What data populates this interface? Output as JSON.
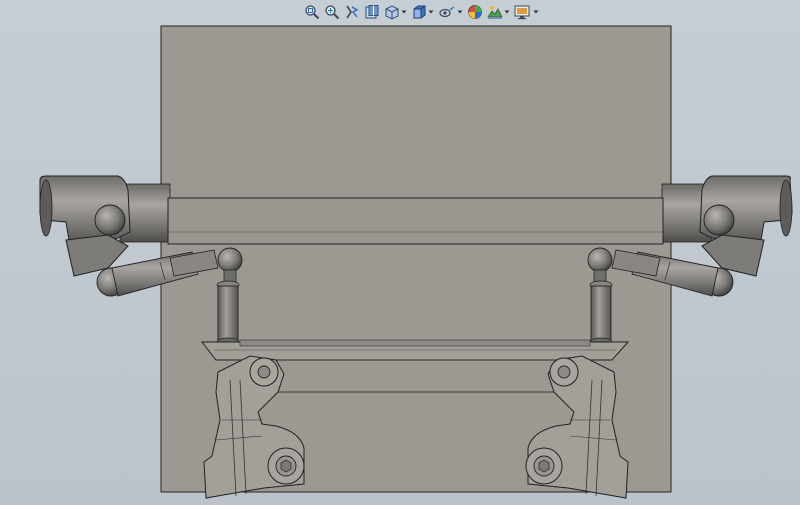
{
  "app": {
    "view": "cad-graphics-area"
  },
  "colors": {
    "background": "#c4ccd3",
    "plate": "#9c9892",
    "part": "#7d7b78",
    "part_light": "#a6a39f",
    "part_dark": "#4a4947",
    "edge": "#1e1e1e"
  },
  "toolbar": {
    "tools": [
      {
        "name": "zoom-to-fit-icon",
        "has_menu": false
      },
      {
        "name": "zoom-to-area-icon",
        "has_menu": false
      },
      {
        "name": "previous-view-icon",
        "has_menu": false
      },
      {
        "name": "section-view-icon",
        "has_menu": false
      },
      {
        "name": "view-orientation-icon",
        "has_menu": true
      },
      {
        "name": "display-style-icon",
        "has_menu": true
      },
      {
        "name": "hide-show-items-icon",
        "has_menu": true
      },
      {
        "name": "edit-appearance-icon",
        "has_menu": false
      },
      {
        "name": "apply-scene-icon",
        "has_menu": true
      },
      {
        "name": "view-settings-icon",
        "has_menu": true
      }
    ]
  }
}
